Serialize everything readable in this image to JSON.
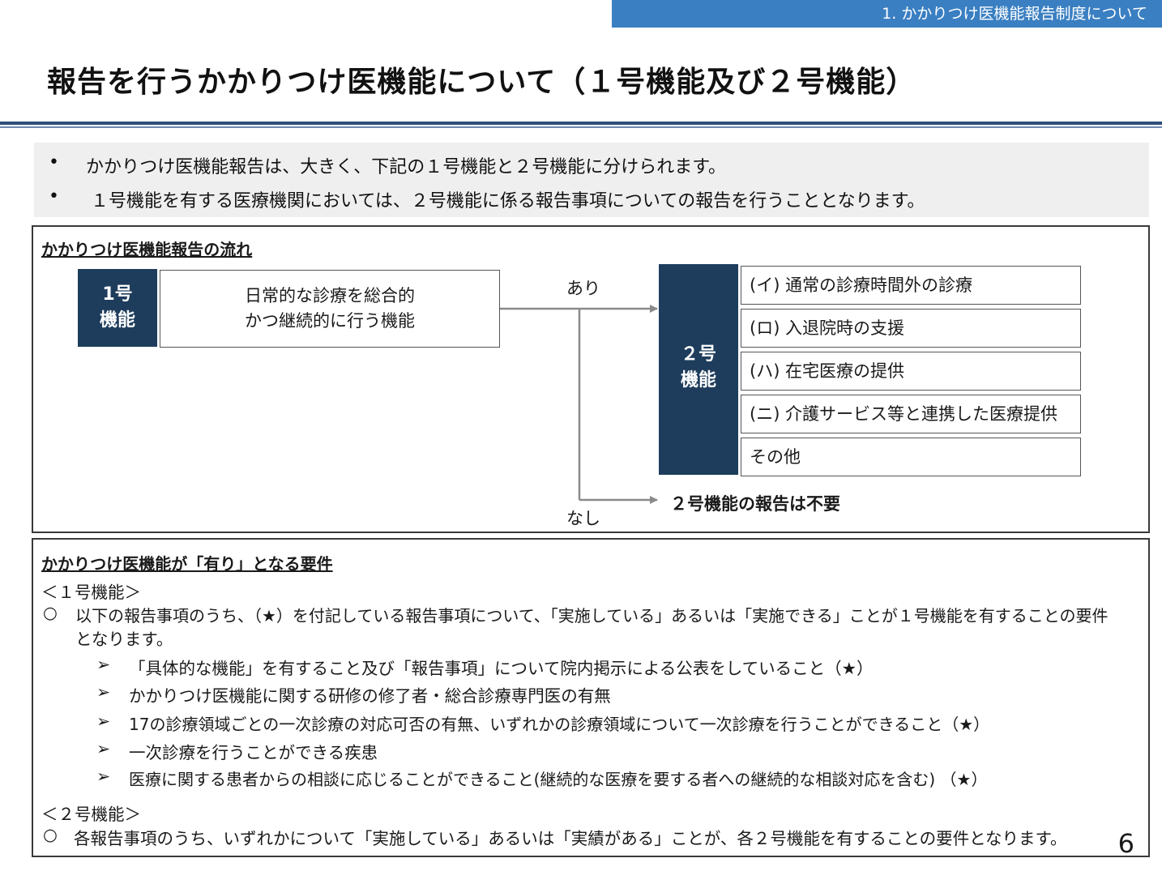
{
  "header": {
    "section": "1. かかりつけ医機能報告制度について",
    "title": "報告を行うかかりつけ医機能について（１号機能及び２号機能）"
  },
  "summary": {
    "bullets": [
      "かかりつけ医機能報告は、大きく、下記の１号機能と２号機能に分けられます。",
      "１号機能を有する医療機関においては、２号機能に係る報告事項についての報告を行うこととなります。"
    ]
  },
  "flow": {
    "title": "かかりつけ医機能報告の流れ",
    "func1_label": "1号\n機能",
    "func1_desc": "日常的な診療を総合的\nかつ継続的に行う機能",
    "yes_label": "あり",
    "no_label": "なし",
    "func2_label": "２号\n機能",
    "func2_items": [
      "(イ) 通常の診療時間外の診療",
      "(ロ) 入退院時の支援",
      "(ハ) 在宅医療の提供",
      "(ニ) 介護サービス等と連携した医療提供",
      "その他"
    ],
    "no_report": "２号機能の報告は不要"
  },
  "requirements": {
    "title": "かかりつけ医機能が「有り」となる要件",
    "func1_heading": "＜１号機能＞",
    "func1_circle": "○",
    "func1_intro_line1": "以下の報告事項のうち、（★）を付記している報告事項について、「実施している」あるいは「実施できる」ことが１号機能を有することの要件",
    "func1_intro_line2": "となります。",
    "arrow": "➢",
    "func1_items": [
      "「具体的な機能」を有すること及び「報告事項」について院内掲示による公表をしていること（★）",
      "かかりつけ医機能に関する研修の修了者・総合診療専門医の有無",
      "17の診療領域ごとの一次診療の対応可否の有無、いずれかの診療領域について一次診療を行うことができること（★）",
      "一次診療を行うことができる疾患",
      "医療に関する患者からの相談に応じることができること(継続的な医療を要する者への継続的な相談対応を含む) （★）"
    ],
    "func2_heading": "＜２号機能＞",
    "func2_circle": "○",
    "func2_text": "各報告事項のうち、いずれかについて「実施している」あるいは「実績がある」ことが、各２号機能を有することの要件となります。"
  },
  "page_number": "6"
}
